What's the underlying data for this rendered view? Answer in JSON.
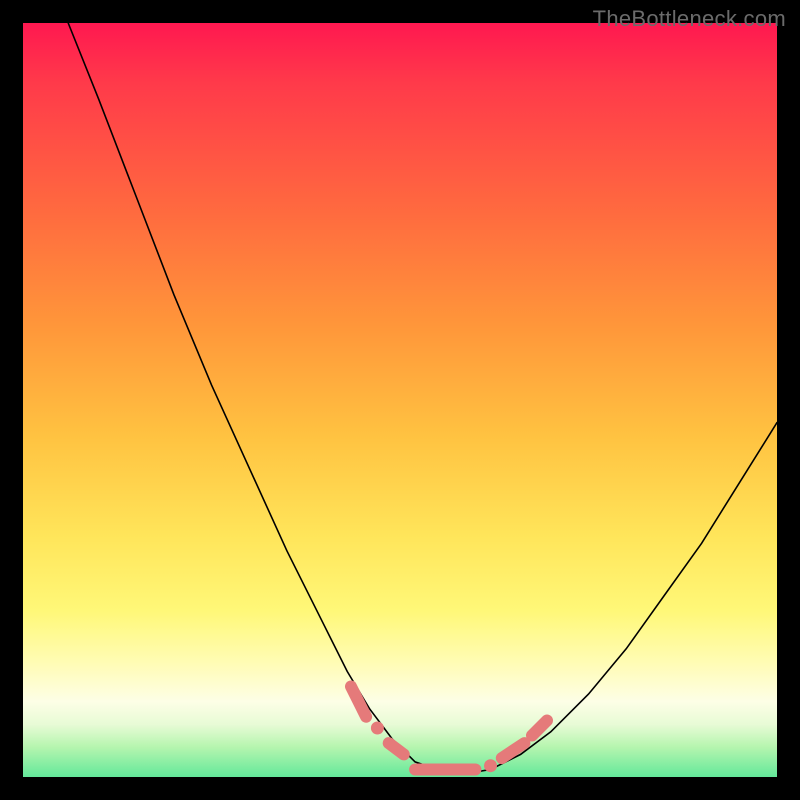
{
  "watermark": {
    "text": "TheBottleneck.com"
  },
  "colors": {
    "background": "#000000",
    "gradient_top": "#ff1850",
    "gradient_mid": "#ffe55a",
    "gradient_bottom": "#63e89a",
    "curve": "#000000",
    "markers": "#e57a7a"
  },
  "chart_data": {
    "type": "line",
    "title": "",
    "xlabel": "",
    "ylabel": "",
    "xlim": [
      0,
      100
    ],
    "ylim": [
      0,
      100
    ],
    "grid": false,
    "series": [
      {
        "name": "bottleneck-curve",
        "x": [
          6,
          10,
          15,
          20,
          25,
          30,
          35,
          40,
          43,
          46,
          49,
          52,
          55,
          57,
          59,
          62,
          66,
          70,
          75,
          80,
          85,
          90,
          95,
          100
        ],
        "y": [
          100,
          90,
          77,
          64,
          52,
          41,
          30,
          20,
          14,
          9,
          5,
          2,
          1,
          0.5,
          0.5,
          1,
          3,
          6,
          11,
          17,
          24,
          31,
          39,
          47
        ]
      }
    ],
    "annotations": [
      {
        "kind": "marker-segment",
        "x_range": [
          43.5,
          45.5
        ],
        "y_range": [
          12,
          8
        ]
      },
      {
        "kind": "marker-dot",
        "x": 47,
        "y": 6.5
      },
      {
        "kind": "marker-segment",
        "x_range": [
          48.5,
          50.5
        ],
        "y_range": [
          4.5,
          3
        ]
      },
      {
        "kind": "marker-segment",
        "x_range": [
          52,
          60
        ],
        "y_range": [
          1,
          1
        ]
      },
      {
        "kind": "marker-dot",
        "x": 62,
        "y": 1.5
      },
      {
        "kind": "marker-segment",
        "x_range": [
          63.5,
          66.5
        ],
        "y_range": [
          2.5,
          4.5
        ]
      },
      {
        "kind": "marker-segment",
        "x_range": [
          67.5,
          69.5
        ],
        "y_range": [
          5.5,
          7.5
        ]
      }
    ]
  }
}
